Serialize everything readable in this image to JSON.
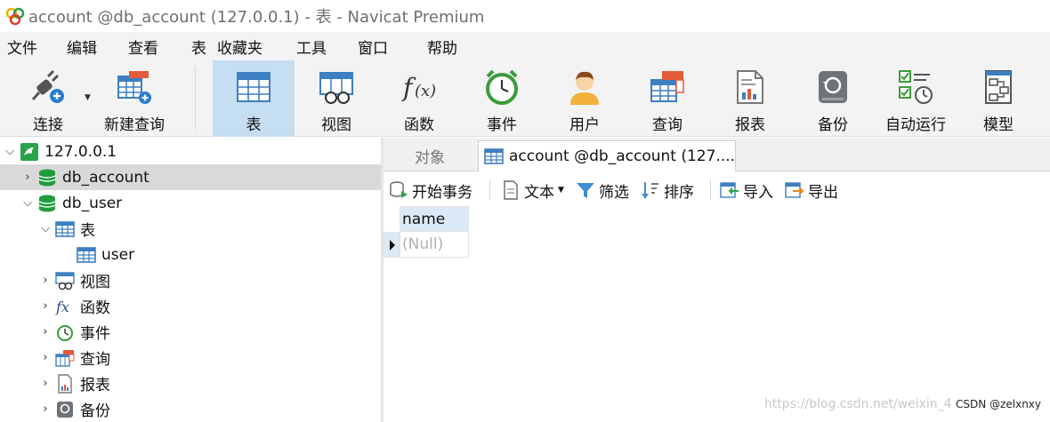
{
  "window": {
    "title": "account @db_account (127.0.0.1) - 表 - Navicat Premium"
  },
  "menu": [
    "文件",
    "编辑",
    "查看",
    "表",
    "收藏夹",
    "工具",
    "窗口",
    "帮助"
  ],
  "toolbar": {
    "buttons": [
      {
        "label": "连接",
        "icon": "plug-add-icon"
      },
      {
        "label": "新建查询",
        "icon": "new-query-icon"
      },
      {
        "label": "表",
        "icon": "table-icon",
        "active": true
      },
      {
        "label": "视图",
        "icon": "view-icon"
      },
      {
        "label": "函数",
        "icon": "function-icon"
      },
      {
        "label": "事件",
        "icon": "alarm-clock-icon"
      },
      {
        "label": "用户",
        "icon": "user-icon"
      },
      {
        "label": "查询",
        "icon": "query-icon"
      },
      {
        "label": "报表",
        "icon": "report-icon"
      },
      {
        "label": "备份",
        "icon": "backup-icon"
      },
      {
        "label": "自动运行",
        "icon": "automation-icon"
      },
      {
        "label": "模型",
        "icon": "model-icon"
      }
    ]
  },
  "tree": {
    "connection": "127.0.0.1",
    "databases": [
      "db_account",
      "db_user"
    ],
    "objects": {
      "tables": "表",
      "table_user": "user",
      "views": "视图",
      "functions": "函数",
      "events": "事件",
      "queries": "查询",
      "reports": "报表",
      "backups": "备份"
    }
  },
  "tabs": {
    "objects": "对象",
    "current": "account @db_account (127...."
  },
  "subtoolbar": {
    "begin_transaction": "开始事务",
    "text": "文本",
    "filter": "筛选",
    "sort": "排序",
    "import": "导入",
    "export": "导出"
  },
  "grid": {
    "column": "name",
    "value": "(Null)"
  },
  "watermark": {
    "url": "https://blog.csdn.net/weixin_4",
    "brand": "CSDN @zelxnxy"
  },
  "colors": {
    "accent_selected": "#c6def2",
    "tree_selected": "#d9d9d9",
    "db_green": "#1f9e3a",
    "table_blue": "#3d7fc1"
  }
}
